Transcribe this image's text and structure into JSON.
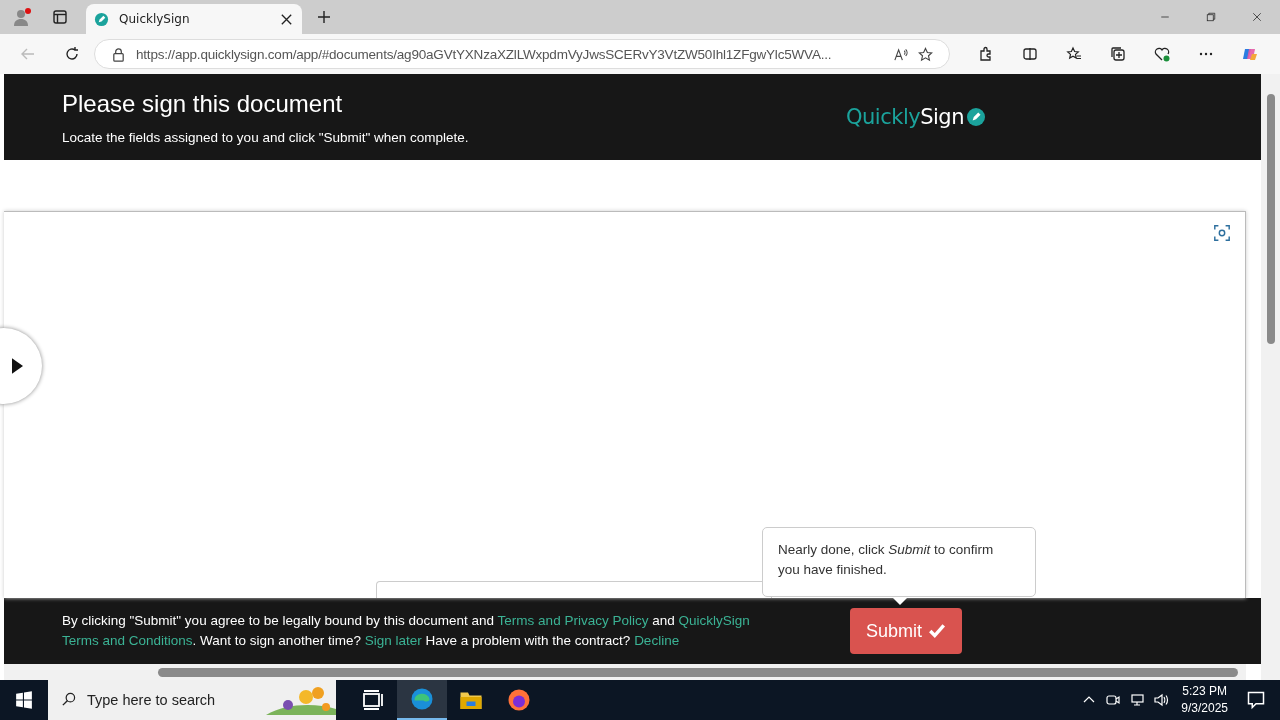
{
  "browser": {
    "tabs": [
      {
        "title": "QuicklySign",
        "selected": true
      }
    ],
    "url": "https://app.quicklysign.com/app/#documents/ag90aGVtYXNzaXZlLWxpdmVyJwsSCERvY3VtZW50Ihl1ZFgwYlc5WVA..."
  },
  "header": {
    "title": "Please sign this document",
    "subtitle": "Locate the fields assigned to you and click \"Submit\" when complete.",
    "logo_light": "Quickly",
    "logo_bold": "Sign"
  },
  "tooltip": {
    "text": "Nearly done, click *Submit* to confirm you have finished."
  },
  "footer": {
    "segments": [
      {
        "kind": "text",
        "text": "By clicking \"Submit\" you agree to be legally bound by this document and"
      },
      {
        "kind": "link",
        "text": "Terms and Privacy Policy"
      },
      {
        "kind": "text",
        "text": "and"
      },
      {
        "kind": "link",
        "text": "QuicklySign"
      },
      {
        "kind": "link",
        "text": "Terms and Conditions"
      },
      {
        "kind": "text",
        "text": ". Want to sign another time?",
        "glue": true
      },
      {
        "kind": "link",
        "text": "Sign later"
      },
      {
        "kind": "text",
        "text": "Have a problem with the contract?"
      },
      {
        "kind": "link",
        "text": "Decline"
      }
    ],
    "submit": "Submit"
  },
  "taskbar": {
    "search_placeholder": "Type here to search",
    "time": "5:23 PM",
    "date": "9/3/2025"
  }
}
